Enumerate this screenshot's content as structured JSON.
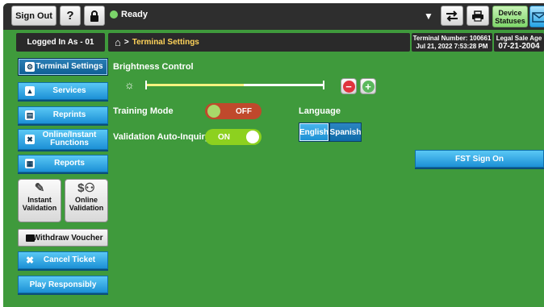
{
  "topbar": {
    "sign_out": "Sign Out",
    "help": "?",
    "status": "Ready",
    "device_statuses": "Device Statuses"
  },
  "header": {
    "logged_in": "Logged In As - 01",
    "breadcrumb": "Terminal Settings",
    "terminal_number": "Terminal Number: 100661",
    "datetime": "Jul 21, 2022 7:53:28 PM",
    "legal_age_label": "Legal Sale Age",
    "legal_age_date": "07-21-2004"
  },
  "sidebar": {
    "terminal_settings": "Terminal Settings",
    "services": "Services",
    "reprints": "Reprints",
    "online_instant": "Online/Instant Functions",
    "reports": "Reports",
    "instant_validation": "Instant Validation",
    "online_validation": "Online Validation",
    "withdraw_voucher": "Withdraw Voucher",
    "cancel_ticket": "Cancel Ticket",
    "play_responsibly": "Play Responsibly"
  },
  "settings": {
    "brightness_label": "Brightness Control",
    "brightness_level": 0.55,
    "training_label": "Training Mode",
    "training_state": "OFF",
    "validation_label": "Validation Auto-Inquiry",
    "validation_state": "ON",
    "language_label": "Language",
    "lang_english": "English",
    "lang_spanish": "Spanish",
    "selected_language": "English",
    "fst_sign_on": "FST Sign On"
  },
  "colors": {
    "background": "#3f9a3c",
    "accent": "#1c90d6",
    "toggle_on": "#8dd11f",
    "toggle_off": "#c0492c"
  },
  "icons": [
    "help-icon",
    "lock-icon",
    "status-dot-icon",
    "chevron-down-icon",
    "transfer-icon",
    "printer-icon",
    "mail-icon",
    "home-icon",
    "gear-icon",
    "warning-icon",
    "document-icon",
    "ticket-icon",
    "report-icon",
    "sun-icon",
    "minus-icon",
    "plus-icon"
  ]
}
